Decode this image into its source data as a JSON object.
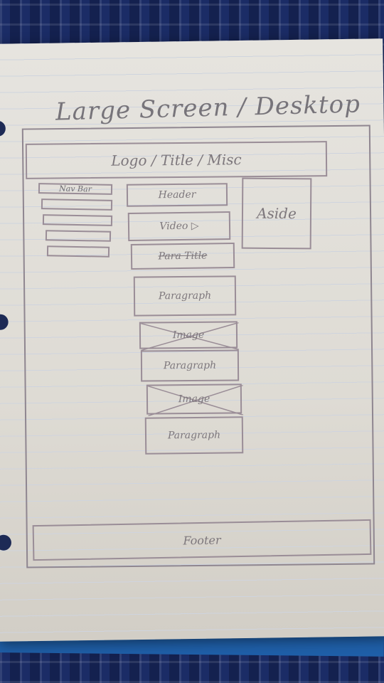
{
  "sketch": {
    "title": "Large Screen / Desktop",
    "header": "Logo / Title / Misc",
    "nav": {
      "label": "Nav Bar"
    },
    "main": {
      "items": [
        {
          "label": "Header",
          "crossed": false,
          "strike": false
        },
        {
          "label": "Video ▷",
          "crossed": false,
          "strike": false
        },
        {
          "label": "Para Title",
          "crossed": false,
          "strike": true
        },
        {
          "label": "Paragraph",
          "crossed": false,
          "strike": false
        },
        {
          "label": "Image",
          "crossed": true,
          "strike": false
        },
        {
          "label": "Paragraph",
          "crossed": false,
          "strike": false
        },
        {
          "label": "Image",
          "crossed": true,
          "strike": false
        },
        {
          "label": "Paragraph",
          "crossed": false,
          "strike": false
        }
      ]
    },
    "aside": "Aside",
    "footer": "Footer"
  }
}
